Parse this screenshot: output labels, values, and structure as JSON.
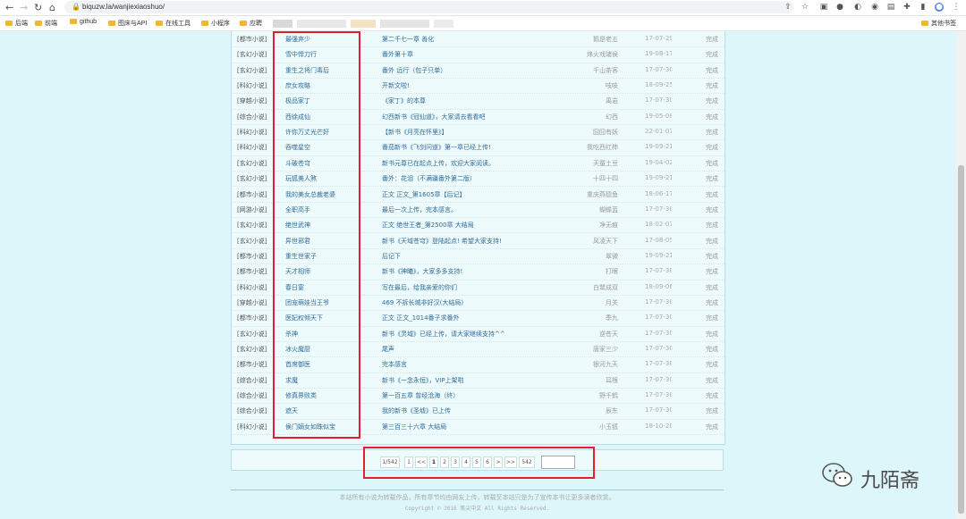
{
  "browser": {
    "url": "biquzw.la/wanjiexiaoshuo/",
    "bookmarks": [
      "后端",
      "前端",
      "github",
      "图床与API",
      "在线工具",
      "小程序",
      "应聘"
    ],
    "other_bookmarks": "其他书签"
  },
  "novels": [
    {
      "category": "[都市小说]",
      "title": "最强弃少",
      "chapter": "第二千七一章 善化",
      "author": "鹅是老五",
      "date": "17-07-29",
      "status": "完成"
    },
    {
      "category": "[玄幻小说]",
      "title": "雪中悍刀行",
      "chapter": "番外第十章",
      "author": "烽火戏诸侯",
      "date": "19-08-17",
      "status": "完成"
    },
    {
      "category": "[玄幻小说]",
      "title": "重生之将门毒后",
      "chapter": "番外 远行（包子只单）",
      "author": "千山茶客",
      "date": "17-07-30",
      "status": "完成"
    },
    {
      "category": "[科幻小说]",
      "title": "庶女攻略",
      "chapter": "开新文啦!",
      "author": "吱吱",
      "date": "18-09-25",
      "status": "完成"
    },
    {
      "category": "[穿越小说]",
      "title": "极品家丁",
      "chapter": "《家丁》的本尊",
      "author": "禹岩",
      "date": "17-07-30",
      "status": "完成"
    },
    {
      "category": "[综合小说]",
      "title": "西徐成仙",
      "chapter": "幻西新书《冠仙道》，大家请去看看吧",
      "author": "幻西",
      "date": "19-05-08",
      "status": "完成"
    },
    {
      "category": "[科幻小说]",
      "title": "许你万丈光芒好",
      "chapter": "【新书《月亮在怀里》】",
      "author": "囧囧有妖",
      "date": "22-01-07",
      "status": "完成"
    },
    {
      "category": "[科幻小说]",
      "title": "吞噬星空",
      "chapter": "番茄新书《飞剑问道》第一章已经上传!",
      "author": "我吃西红柿",
      "date": "19-09-21",
      "status": "完成"
    },
    {
      "category": "[玄幻小说]",
      "title": "斗破苍穹",
      "chapter": "新书元尊已在起点上传，欢迎大家阅读。",
      "author": "天蚕土豆",
      "date": "19-04-02",
      "status": "完成"
    },
    {
      "category": "[玄幻小说]",
      "title": "玩狐美人煞",
      "chapter": "番外：花泪（不满疆番外第二版）",
      "author": "十四十四",
      "date": "19-09-21",
      "status": "完成"
    },
    {
      "category": "[都市小说]",
      "title": "我的美女总裁老婆",
      "chapter": "正文 正文_第1605章【后记】",
      "author": "重庆燕德鱼",
      "date": "18-06-17",
      "status": "完成"
    },
    {
      "category": "[网游小说]",
      "title": "全职高手",
      "chapter": "最后一次上传，完本感言。",
      "author": "蝴蝶蓝",
      "date": "17-07-30",
      "status": "完成"
    },
    {
      "category": "[玄幻小说]",
      "title": "绝世武神",
      "chapter": "正文 绝世王者_第2500章 大结局",
      "author": "净无痕",
      "date": "18-02-07",
      "status": "完成"
    },
    {
      "category": "[玄幻小说]",
      "title": "异世邪君",
      "chapter": "新书《天域苍穹》登陆起点! 希望大家支持!",
      "author": "风凌天下",
      "date": "17-08-05",
      "status": "完成"
    },
    {
      "category": "[都市小说]",
      "title": "重生世家子",
      "chapter": "后记下",
      "author": "翠微",
      "date": "19-09-21",
      "status": "完成"
    },
    {
      "category": "[都市小说]",
      "title": "天才相师",
      "chapter": "新书《神曦》，大家多多支持!",
      "author": "打眼",
      "date": "17-07-30",
      "status": "完成"
    },
    {
      "category": "[科幻小说]",
      "title": "春日宴",
      "chapter": "写在最后，给我亲爱的你们",
      "author": "白鹭成双",
      "date": "18-09-06",
      "status": "完成"
    },
    {
      "category": "[穿越小说]",
      "title": "团宠萌娃当王爷",
      "chapter": "469 不拆长城非好汉(大结局)",
      "author": "月关",
      "date": "17-07-30",
      "status": "完成"
    },
    {
      "category": "[都市小说]",
      "title": "医妃权倾天下",
      "chapter": "正文 正文_1014番子求番外",
      "author": "季九",
      "date": "17-07-30",
      "status": "完成"
    },
    {
      "category": "[玄幻小说]",
      "title": "杀神",
      "chapter": "新书《灵域》已经上传，请大家继续支持^^",
      "author": "逆苍天",
      "date": "17-07-30",
      "status": "完成"
    },
    {
      "category": "[玄幻小说]",
      "title": "冰火魔厨",
      "chapter": "尾声",
      "author": "唐家三少",
      "date": "17-07-30",
      "status": "完成"
    },
    {
      "category": "[都市小说]",
      "title": "首席御医",
      "chapter": "完本感言",
      "author": "银河九天",
      "date": "17-07-30",
      "status": "完成"
    },
    {
      "category": "[综合小说]",
      "title": "求魔",
      "chapter": "新书《一念永恒》，VIP上架啦",
      "author": "耳根",
      "date": "17-07-30",
      "status": "完成"
    },
    {
      "category": "[综合小说]",
      "title": "修真界败类",
      "chapter": "第一百五章 曾经沧海（终）",
      "author": "野千鹤",
      "date": "17-07-30",
      "status": "完成"
    },
    {
      "category": "[综合小说]",
      "title": "遮天",
      "chapter": "我的新书《圣墟》已上传",
      "author": "辰东",
      "date": "17-07-30",
      "status": "完成"
    },
    {
      "category": "[科幻小说]",
      "title": "侯门嫡女如珠似宝",
      "chapter": "第三百三十六章 大结局",
      "author": "小玉狐",
      "date": "18-10-20",
      "status": "完成"
    }
  ],
  "pagination": {
    "page_info": "1/542",
    "first": "1",
    "prev": "<<",
    "pages": [
      "1",
      "2",
      "3",
      "4",
      "5",
      "6"
    ],
    "next": ">",
    "last_arrow": ">>",
    "last": "542"
  },
  "footer": {
    "notice": "本站所有小说为转载作品，所有章节均由网友上传，转载至本站只是为了宣传本书让更多读者欣赏。",
    "copyright": "Copyright © 2016 笔尖中文 All Rights Reserved."
  },
  "watermark": {
    "text": "九陌斋"
  },
  "colors": {
    "page_bg": "#ddf6f9",
    "link": "#2f6c9a",
    "highlight": "#e0212b"
  }
}
